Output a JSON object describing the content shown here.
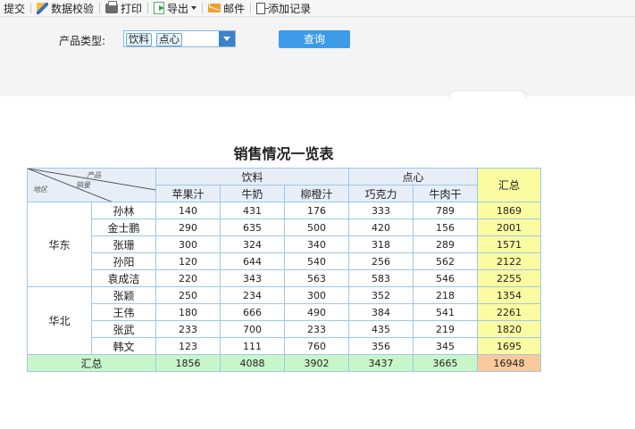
{
  "toolbar": {
    "items": [
      {
        "label": "提交",
        "icon": "none"
      },
      {
        "label": "数据校验",
        "icon": "pen-icon"
      },
      {
        "label": "打印",
        "icon": "print-icon"
      },
      {
        "label": "导出",
        "icon": "export-icon"
      },
      {
        "label": "邮件",
        "icon": "mail-icon"
      },
      {
        "label": "添加记录",
        "icon": "add-record-icon"
      }
    ]
  },
  "filter": {
    "label": "产品类型:",
    "selected": [
      "饮料",
      "点心"
    ],
    "query_label": "查询"
  },
  "report": {
    "title": "销售情况一览表",
    "corner": {
      "product": "产品",
      "sales": "销量",
      "region": "地区"
    },
    "groups": [
      {
        "label": "饮料",
        "products": [
          "苹果汁",
          "牛奶",
          "柳橙汁"
        ]
      },
      {
        "label": "点心",
        "products": [
          "巧克力",
          "牛肉干"
        ]
      }
    ],
    "total_header": "汇总",
    "regions": [
      {
        "name": "华东",
        "rows": [
          {
            "name": "孙林",
            "values": [
              "140",
              "431",
              "176",
              "333",
              "789"
            ],
            "total": "1869"
          },
          {
            "name": "金士鹏",
            "values": [
              "290",
              "635",
              "500",
              "420",
              "156"
            ],
            "total": "2001"
          },
          {
            "name": "张珊",
            "values": [
              "300",
              "324",
              "340",
              "318",
              "289"
            ],
            "total": "1571"
          },
          {
            "name": "孙阳",
            "values": [
              "120",
              "644",
              "540",
              "256",
              "562"
            ],
            "total": "2122"
          },
          {
            "name": "袁成洁",
            "values": [
              "220",
              "343",
              "563",
              "583",
              "546"
            ],
            "total": "2255"
          }
        ]
      },
      {
        "name": "华北",
        "rows": [
          {
            "name": "张颖",
            "values": [
              "250",
              "234",
              "300",
              "352",
              "218"
            ],
            "total": "1354"
          },
          {
            "name": "王伟",
            "values": [
              "180",
              "666",
              "490",
              "384",
              "541"
            ],
            "total": "2261"
          },
          {
            "name": "张武",
            "values": [
              "233",
              "700",
              "233",
              "435",
              "219"
            ],
            "total": "1820"
          },
          {
            "name": "韩文",
            "values": [
              "123",
              "111",
              "760",
              "356",
              "345"
            ],
            "total": "1695"
          }
        ]
      }
    ],
    "grand": {
      "label": "汇总",
      "values": [
        "1856",
        "4088",
        "3902",
        "3437",
        "3665"
      ],
      "total": "16948"
    }
  }
}
